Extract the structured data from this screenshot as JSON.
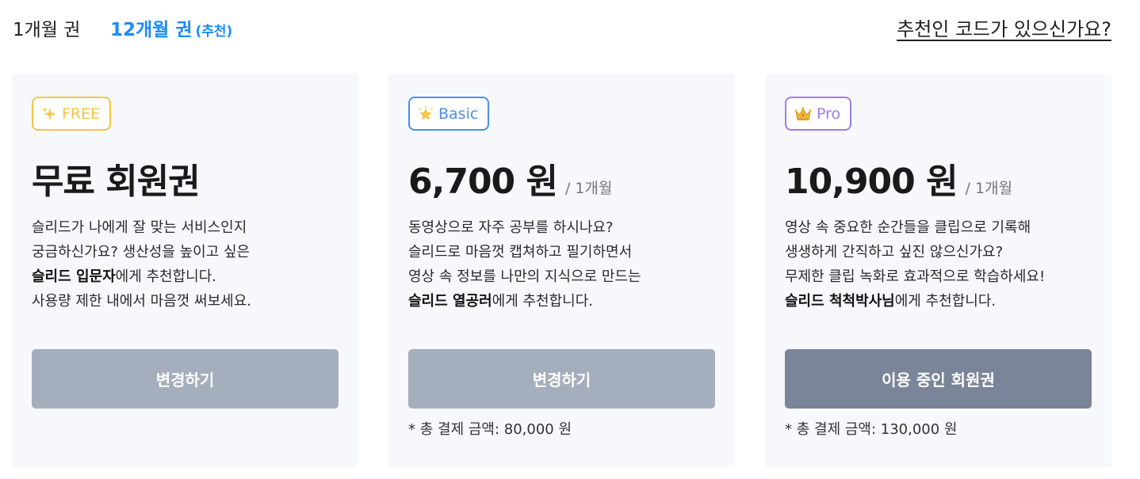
{
  "header": {
    "tab_1m": "1개월 권",
    "tab_12m": "12개월 권",
    "tab_12m_recommend": "(추천)",
    "referral_link": "추천인 코드가 있으신가요?"
  },
  "colors": {
    "accent": "#1a8cff",
    "free_badge": "#f5c542",
    "basic_badge": "#4a8fe8",
    "pro_badge": "#9b7cf0",
    "button_grey": "#a5aebd",
    "button_dark": "#7b8599"
  },
  "plans": [
    {
      "badge_icon": "sparkles-icon",
      "badge_label": "FREE",
      "price": "무료 회원권",
      "period": "",
      "desc_line1": "슬리드가 나에게 잘 맞는 서비스인지",
      "desc_line2": "궁금하신가요? 생산성을 높이고 싶은",
      "desc_bold": "슬리드 입문자",
      "desc_tail": "에게 추천합니다.",
      "desc_line4": "사용량 제한 내에서 마음껏 써보세요.",
      "button_label": "변경하기",
      "total": ""
    },
    {
      "badge_icon": "glowing-star-icon",
      "badge_label": "Basic",
      "price": "6,700 원",
      "period": "/ 1개월",
      "desc_line1": "동영상으로 자주 공부를 하시나요?",
      "desc_line2": "슬리드로 마음껏 캡쳐하고 필기하면서",
      "desc_line3": "영상 속 정보를 나만의 지식으로 만드는",
      "desc_bold": "슬리드 열공러",
      "desc_tail": "에게 추천합니다.",
      "button_label": "변경하기",
      "total": "* 총 결제 금액: 80,000 원"
    },
    {
      "badge_icon": "crown-icon",
      "badge_label": "Pro",
      "price": "10,900 원",
      "period": "/ 1개월",
      "desc_line1": "영상 속 중요한 순간들을 클립으로 기록해",
      "desc_line2": "생생하게 간직하고 싶진 않으신가요?",
      "desc_line3": "무제한 클립 녹화로 효과적으로 학습하세요!",
      "desc_bold": "슬리드 척척박사님",
      "desc_tail": "에게 추천합니다.",
      "button_label": "이용 중인 회원권",
      "total": "* 총 결제 금액: 130,000 원"
    }
  ]
}
